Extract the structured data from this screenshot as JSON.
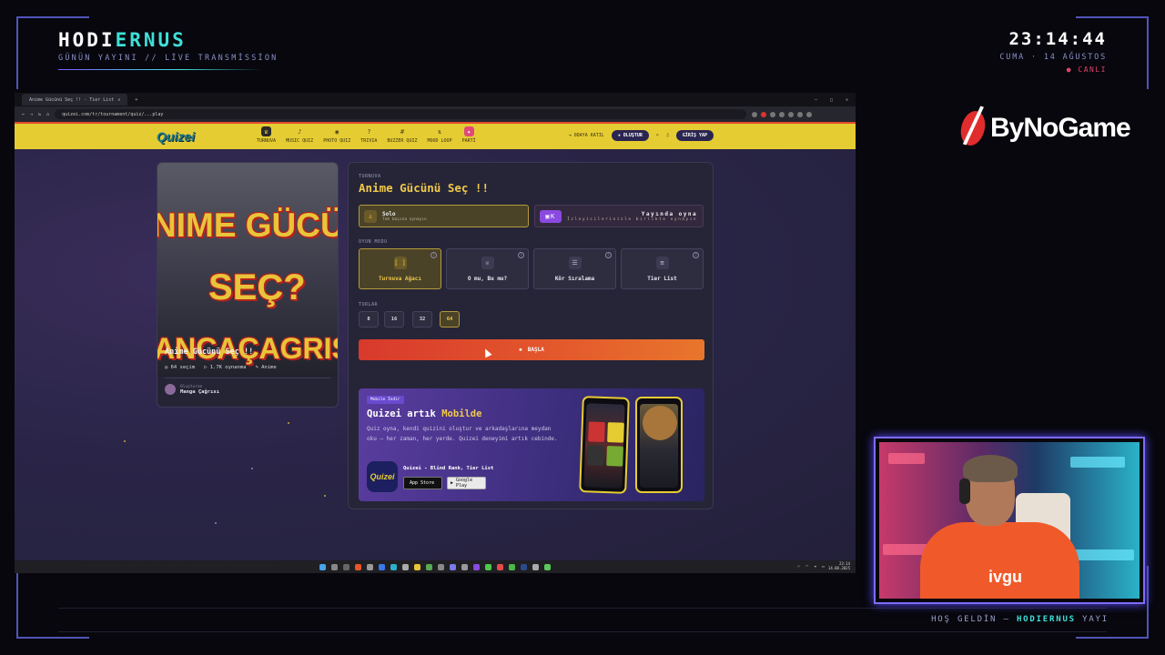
{
  "overlay": {
    "brand_left": "HODI",
    "brand_right": "ERNUS",
    "brand_sub": "GÜNÜN YAYINI // LİVE TRANSMİSSİON",
    "clock": "23:14:44",
    "date": "CUMA · 14 AĞUSTOS",
    "live": "● CANLI",
    "sponsor": "ByNoGame",
    "welcome_prefix": "HOŞ GELDİN — ",
    "welcome_name": "HODIERNUS",
    "welcome_suffix": " YAYI"
  },
  "browser": {
    "tab_title": "Anime Gücünü Seç !! - Tier List",
    "url": "quizei.com/tr/tournament/quiz/...play",
    "new_tab": "+"
  },
  "site": {
    "logo": "Quizei",
    "nav": [
      {
        "label": "TURNUVA",
        "icon": "trophy-icon"
      },
      {
        "label": "MUSIC QUIZ",
        "icon": "music-icon"
      },
      {
        "label": "PHOTO QUIZ",
        "icon": "camera-icon"
      },
      {
        "label": "TRIVIA",
        "icon": "question-icon"
      },
      {
        "label": "BUZZER QUIZ",
        "icon": "buzzer-icon"
      },
      {
        "label": "MOOD LOOP",
        "icon": "loop-icon"
      },
      {
        "label": "PARTİ",
        "icon": "party-icon"
      }
    ],
    "join_room": "ODAYA KATIL",
    "create": "+ OLUŞTUR",
    "login": "GİRİŞ YAP"
  },
  "card": {
    "poster_line1": "NIME GÜCÜN",
    "poster_line2": "SEÇ?",
    "poster_line3": "ANCAÇAGRISI",
    "title": "Anime Gücünü Seç !!",
    "meta": [
      "64 seçim",
      "1.7K oynanma",
      "Anime"
    ],
    "creator_label": "Oluşturan",
    "creator_name": "Manga Çağrısı"
  },
  "panel": {
    "kicker": "TURNUVA",
    "title": "Anime Gücünü Seç !!",
    "solo_name": "Solo",
    "solo_desc": "Tek başına oynayın",
    "live_name": "Yayında oyna",
    "live_desc": "İzleyicilerinizle birlikte oynayın",
    "mode_label": "OYUN MODU",
    "modes": [
      "Turnuva Ağacı",
      "O mu, Bu mu?",
      "Kör Sıralama",
      "Tier List"
    ],
    "rounds_label": "TURLAR",
    "rounds": [
      "8",
      "16",
      "32",
      "64"
    ],
    "start": "BAŞLA"
  },
  "promo": {
    "badge": "Mobile İndir",
    "title_a": "Quizei artık ",
    "title_b": "Mobilde",
    "desc": "Quiz oyna, kendi quizini oluştur ve arkadaşlarına meydan oku — her zaman, her yerde. Quizei deneyimi artık cebinde.",
    "app_icon": "Quizei",
    "app_name": "Quizei - Blind Rank, Tier List",
    "app_store": "App Store",
    "google_play": "Google Play"
  },
  "taskbar": {
    "time": "23:14",
    "date": "14.08.2025"
  }
}
